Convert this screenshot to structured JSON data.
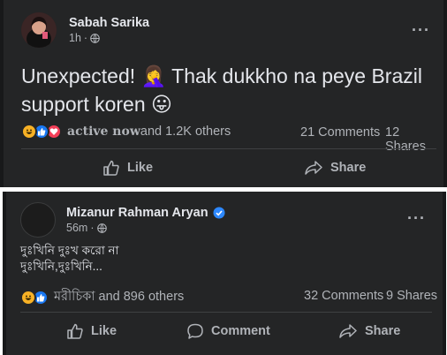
{
  "post1": {
    "author": "Sabah Sarika",
    "time": "1h",
    "text": "Unexpected! 🤦‍♀️ Thak dukkho na peye Brazil support koren 😛",
    "reaction_lead": "active now",
    "reaction_rest": " and 1.2K others",
    "comments": "21 Comments",
    "shares": "12 Shares",
    "actions": {
      "like": "Like",
      "share": "Share"
    }
  },
  "post2": {
    "author": "Mizanur Rahman Aryan",
    "time": "56m",
    "text_line1": "দুঃখিনি দুঃখ করো না",
    "text_line2": "দুঃখিনি,দুঃখিনি...",
    "reaction_summary": "মরীচিকা and 896 others",
    "comments": "32 Comments",
    "shares": "9 Shares",
    "actions": {
      "like": "Like",
      "comment": "Comment",
      "share": "Share"
    }
  }
}
